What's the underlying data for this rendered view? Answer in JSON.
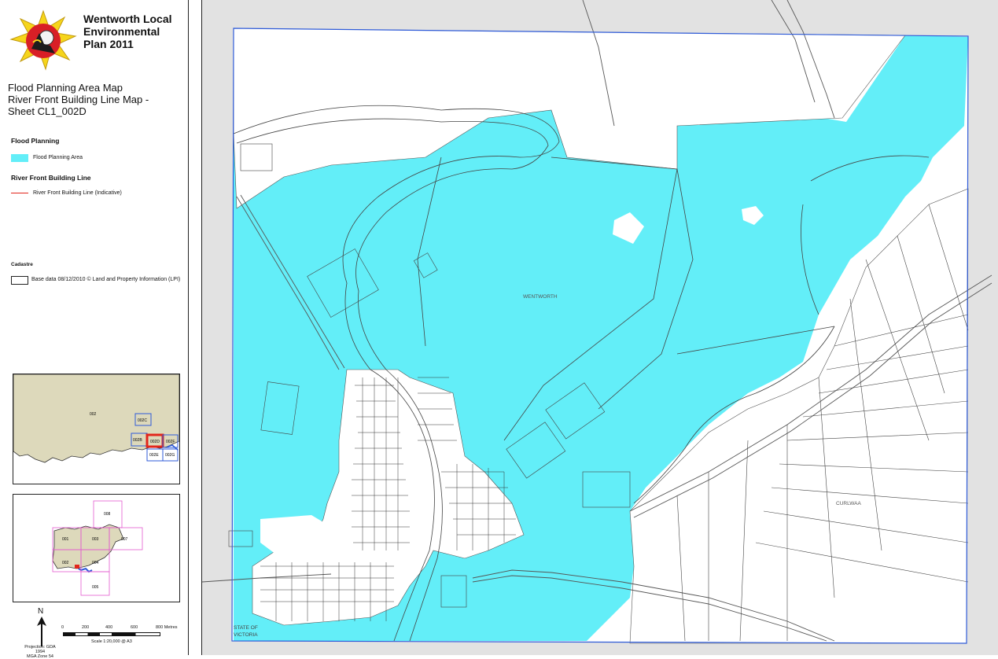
{
  "legend": {
    "title": "Wentworth Local Environmental Plan 2011",
    "map_title_lines": [
      "Flood Planning Area Map",
      "River Front Building Line Map -",
      "Sheet CL1_002D"
    ],
    "sections": {
      "flood_planning": {
        "heading": "Flood Planning",
        "item": "Flood Planning Area"
      },
      "river_front": {
        "heading": "River Front Building Line",
        "item": "River Front Building Line (Indicative)"
      },
      "cadastre": {
        "heading": "Cadastre",
        "item": "Base data 08/12/2010 © Land and Property Information (LPI)"
      }
    },
    "locality_inset": {
      "sheet_labels": [
        "002",
        "002C",
        "002B",
        "002D",
        "002F",
        "002E",
        "002G"
      ]
    },
    "key_map": {
      "sheet_labels": [
        "008",
        "001",
        "003",
        "007",
        "002",
        "004",
        "005"
      ]
    },
    "north_label": "N",
    "scale": {
      "ticks": [
        "0",
        "200",
        "400",
        "600",
        "800 Metres"
      ],
      "text": "Scale 1:20,000 @ A3"
    },
    "projection_lines": [
      "Projection: GDA 1994",
      "MGA Zone 54"
    ]
  },
  "map": {
    "place_labels": {
      "wentworth": "WENTWORTH",
      "curlwaa": "CURLWAA",
      "state": [
        "STATE OF",
        "VICTORIA"
      ]
    }
  },
  "colors": {
    "flood_area": "#63eef8",
    "river_front_line": "#e2261c",
    "sheet_frame": "#2f5bd8",
    "grey_outside": "#e2e2e2",
    "inset_land": "#ddd9bb",
    "key_map_grid": "#e35bcf",
    "selected_sheet": "#e2261c"
  },
  "icons": [
    "wentworth-logo-icon",
    "north-arrow-icon"
  ]
}
